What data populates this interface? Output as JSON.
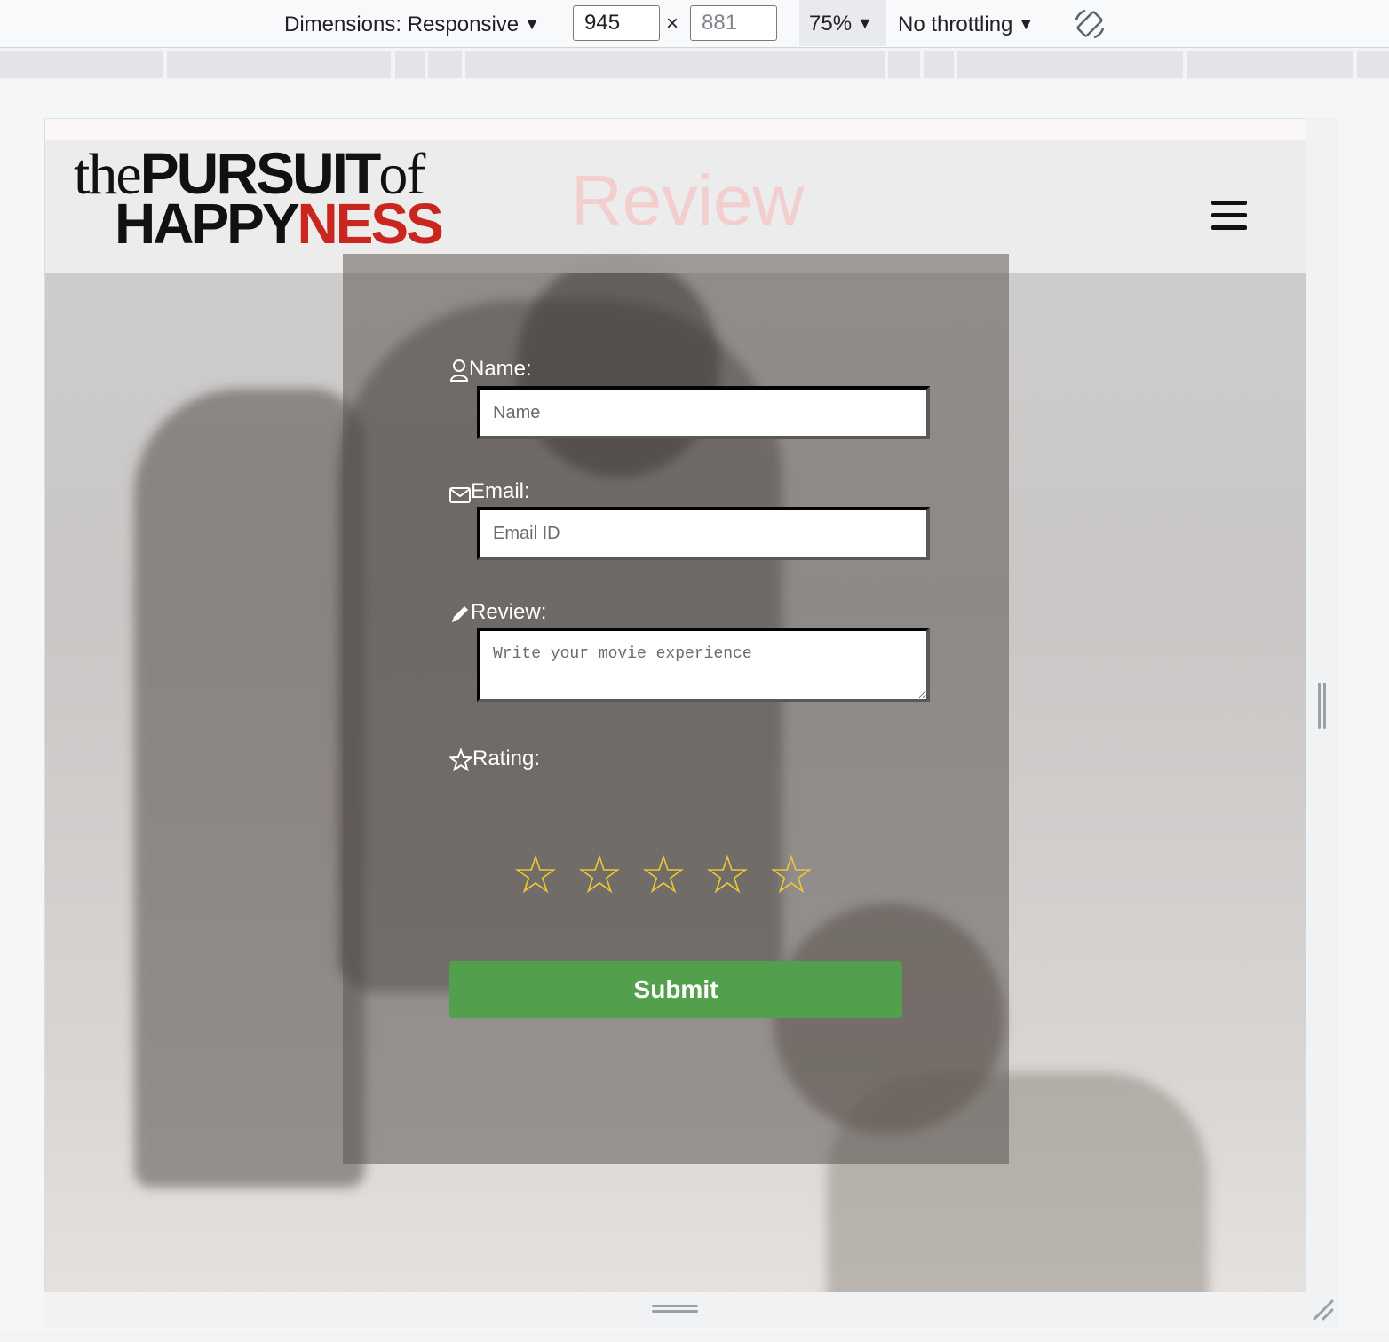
{
  "devtools": {
    "dimensions_label": "Dimensions: Responsive",
    "width_value": "945",
    "times": "×",
    "height_value": "881",
    "zoom": "75%",
    "throttling": "No throttling",
    "rotate_icon": "rotate-icon"
  },
  "site": {
    "logo": {
      "part1": "the",
      "part2": "PURSUIT",
      "part3": "of",
      "part4": "HAPPY",
      "part5": "NESS"
    },
    "hero_title": "Review",
    "menu_icon": "hamburger-icon",
    "colors": {
      "submit": "#52a04d",
      "star": "#e8c53a",
      "logo_red": "#c8261f",
      "title": "#f4c9c9"
    }
  },
  "form": {
    "name_label": "Name:",
    "name_placeholder": "Name",
    "email_label": "Email:",
    "email_placeholder": "Email ID",
    "review_label": "Review:",
    "review_placeholder": "Write your movie experience",
    "rating_label": "Rating:",
    "stars": [
      "☆",
      "☆",
      "☆",
      "☆",
      "☆"
    ],
    "rating_value": 0,
    "submit_label": "Submit"
  }
}
